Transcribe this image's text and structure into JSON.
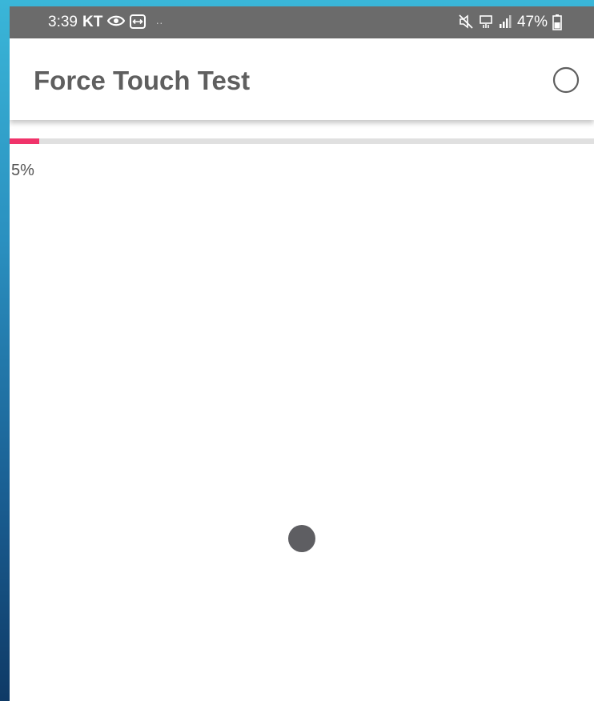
{
  "status_bar": {
    "time": "3:39",
    "carrier": "KT",
    "battery_percent": "47%",
    "icons": [
      "eye-icon",
      "remote-icon",
      "mute-icon",
      "data-icon",
      "signal-icon",
      "battery-icon"
    ]
  },
  "app_bar": {
    "title": "Force Touch Test",
    "action_icon": "circle-outline-icon"
  },
  "progress": {
    "value_fraction": 0.05,
    "label": "5%",
    "fill_color": "#f0336a",
    "track_color": "#e0e0e0"
  },
  "touch_indicator": {
    "color": "#5e5e62"
  }
}
